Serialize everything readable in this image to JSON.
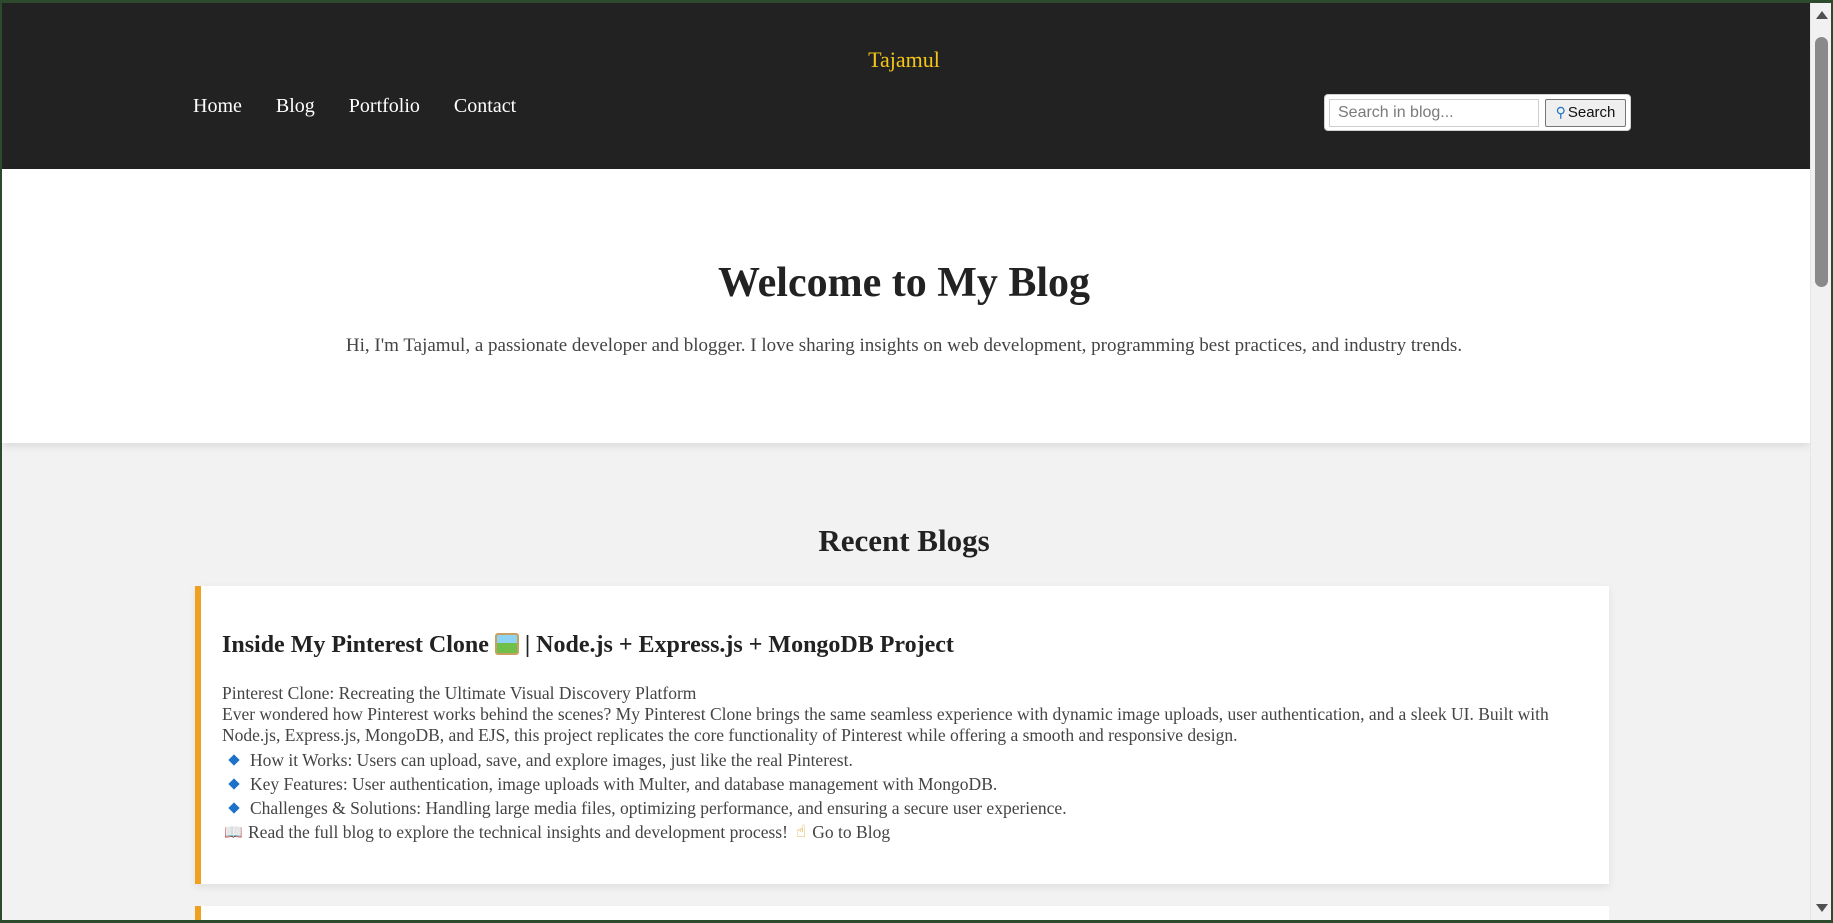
{
  "header": {
    "brand": "Tajamul",
    "nav": [
      "Home",
      "Blog",
      "Portfolio",
      "Contact"
    ],
    "search": {
      "placeholder": "Search in blog...",
      "button_label": "Search",
      "button_icon": "magnifier-icon"
    }
  },
  "hero": {
    "title": "Welcome to My Blog",
    "intro": "Hi, I'm Tajamul, a passionate developer and blogger. I love sharing insights on web development, programming best practices, and industry trends."
  },
  "recent": {
    "title": "Recent Blogs",
    "posts": [
      {
        "title_before_emoji": "Inside My Pinterest Clone",
        "title_after_emoji": "| Node.js + Express.js + MongoDB Project",
        "title_emoji": "framed-picture-icon",
        "subtitle": "Pinterest Clone: Recreating the Ultimate Visual Discovery Platform",
        "body": "Ever wondered how Pinterest works behind the scenes? My Pinterest Clone brings the same seamless experience with dynamic image uploads, user authentication, and a sleek UI. Built with Node.js, Express.js, MongoDB, and EJS, this project replicates the core functionality of Pinterest while offering a smooth and responsive design.",
        "bullets": [
          "How it Works: Users can upload, save, and explore images, just like the real Pinterest.",
          "Key Features: User authentication, image uploads with Multer, and database management with MongoDB.",
          "Challenges & Solutions: Handling large media files, optimizing performance, and ensuring a secure user experience."
        ],
        "cta_text": "Read the full blog to explore the technical insights and development process!",
        "cta_link": "Go to Blog"
      }
    ]
  },
  "colors": {
    "header_bg": "#222222",
    "brand": "#f5c518",
    "card_accent": "#f0a020",
    "bullet": "#1e73c8"
  }
}
